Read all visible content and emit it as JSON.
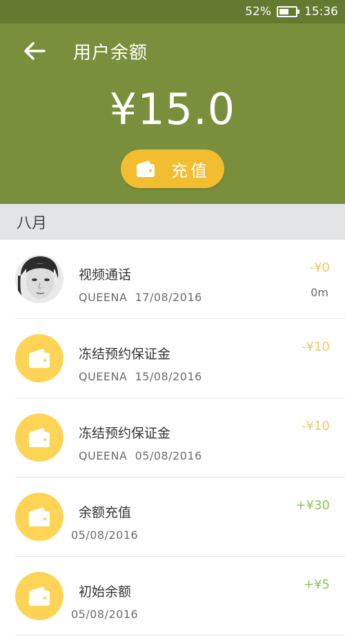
{
  "status_bar": {
    "battery": "52%",
    "time": "15:36"
  },
  "header": {
    "title": "用户余额",
    "balance": "¥15.0",
    "recharge_label": "充值"
  },
  "month": "八月",
  "items": [
    {
      "kind": "avatar",
      "title": "视频通话",
      "user": "QUEENA",
      "date": "17/08/2016",
      "amount": "-¥0",
      "sign": "neg",
      "duration": "0m"
    },
    {
      "kind": "wallet",
      "title": "冻结预约保证金",
      "user": "QUEENA",
      "date": "15/08/2016",
      "amount": "-¥10",
      "sign": "neg"
    },
    {
      "kind": "wallet",
      "title": "冻结预约保证金",
      "user": "QUEENA",
      "date": "05/08/2016",
      "amount": "-¥10",
      "sign": "neg"
    },
    {
      "kind": "wallet",
      "title": "余额充值",
      "user": "",
      "date": "05/08/2016",
      "amount": "+¥30",
      "sign": "pos"
    },
    {
      "kind": "wallet",
      "title": "初始余额",
      "user": "",
      "date": "05/08/2016",
      "amount": "+¥5",
      "sign": "pos"
    }
  ],
  "colors": {
    "status_bar": "#637a30",
    "header": "#7a8f3c",
    "accent_button": "#f3bd30",
    "wallet_circle": "#fdd456",
    "amount_negative": "#f2c56a",
    "amount_positive": "#8cc456",
    "month_bar": "#e2e5e8"
  }
}
